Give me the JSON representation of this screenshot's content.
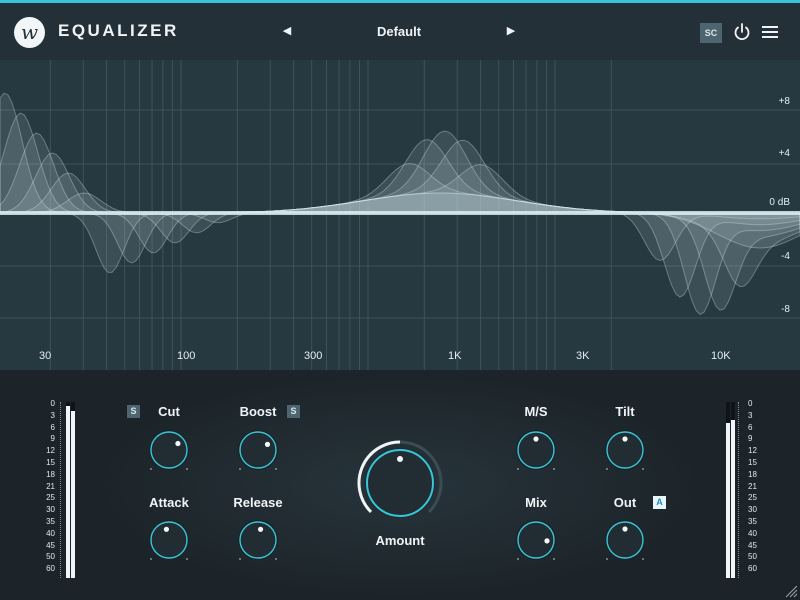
{
  "header": {
    "logo_letter": "w",
    "title": "EQUALIZER",
    "preset": "Default",
    "prev_arrow": "◀",
    "next_arrow": "▶",
    "sc_label": "SC",
    "icons": [
      "logo-icon",
      "power-icon",
      "hamburger-menu-icon"
    ]
  },
  "graph": {
    "db_labels": [
      "+8",
      "+4",
      "0 dB",
      "-4",
      "-8"
    ],
    "freq_labels": [
      "30",
      "100",
      "300",
      "1K",
      "3K",
      "10K"
    ]
  },
  "meters": {
    "scale": [
      "0",
      "3",
      "6",
      "9",
      "12",
      "15",
      "18",
      "21",
      "25",
      "30",
      "35",
      "40",
      "45",
      "50",
      "60"
    ],
    "left_levels": [
      0.98,
      0.95
    ],
    "right_levels": [
      0.88,
      0.9
    ]
  },
  "knobs": [
    {
      "id": "cut",
      "label": "Cut",
      "value": 0.7,
      "badge": "S"
    },
    {
      "id": "boost",
      "label": "Boost",
      "value": 0.72,
      "badge": "S"
    },
    {
      "id": "attack",
      "label": "Attack",
      "value": 0.45
    },
    {
      "id": "release",
      "label": "Release",
      "value": 0.55
    },
    {
      "id": "ms",
      "label": "M/S",
      "value": 0.5
    },
    {
      "id": "tilt",
      "label": "Tilt",
      "value": 0.5
    },
    {
      "id": "mix",
      "label": "Mix",
      "value": 0.85
    },
    {
      "id": "out",
      "label": "Out",
      "value": 0.5,
      "badge": "A"
    }
  ],
  "amount": {
    "label": "Amount",
    "value": 0.5
  },
  "colors": {
    "accent": "#37c6d8",
    "header_bg": "#243038",
    "graph_bg": "#263840",
    "panel_bg": "#1c2429",
    "curve": "#d4e8ee"
  }
}
